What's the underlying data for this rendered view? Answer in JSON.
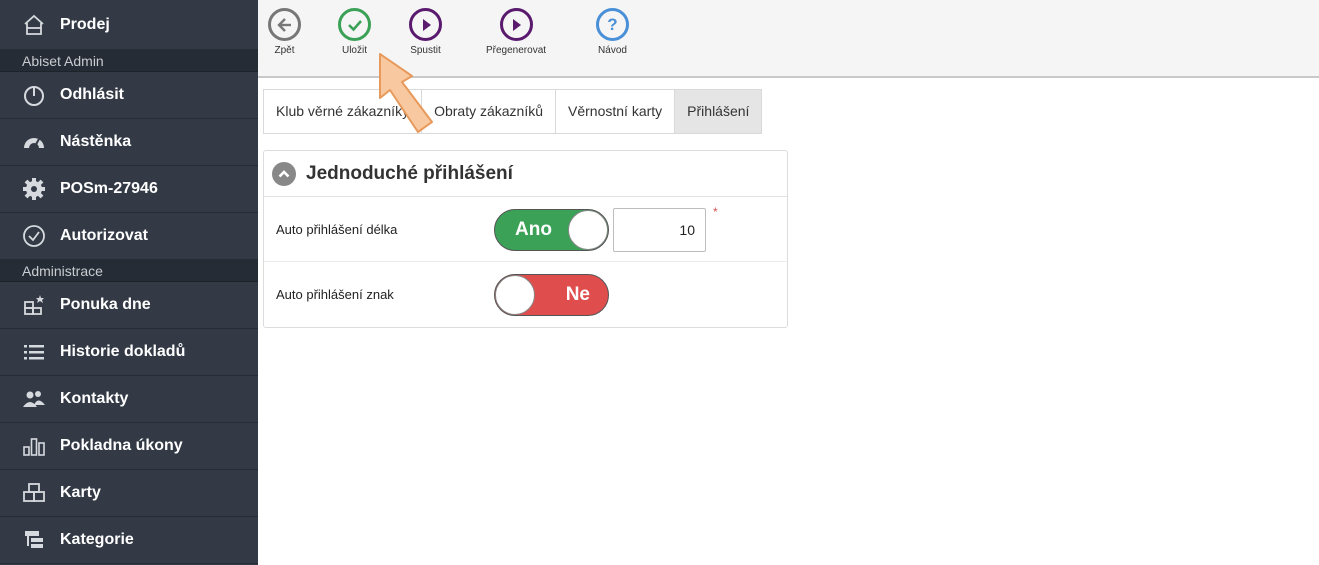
{
  "sidebar": {
    "items": [
      {
        "label": "Prodej",
        "icon": "home-icon"
      },
      {
        "header": "Abiset Admin"
      },
      {
        "label": "Odhlásit",
        "icon": "power-icon"
      },
      {
        "label": "Nástěnka",
        "icon": "dashboard-icon"
      },
      {
        "label": "POSm-27946",
        "icon": "gear-icon"
      },
      {
        "label": "Autorizovat",
        "icon": "check-circle-icon"
      },
      {
        "header": "Administrace"
      },
      {
        "label": "Ponuka dne",
        "icon": "grid-star-icon"
      },
      {
        "label": "Historie dokladů",
        "icon": "list-icon"
      },
      {
        "label": "Kontakty",
        "icon": "users-icon"
      },
      {
        "label": "Pokladna úkony",
        "icon": "bars-icon"
      },
      {
        "label": "Karty",
        "icon": "grid-icon"
      },
      {
        "label": "Kategorie",
        "icon": "category-icon"
      }
    ]
  },
  "toolbar": {
    "buttons": [
      {
        "label": "Zpět",
        "icon": "back-arrow-icon",
        "color": "#777777"
      },
      {
        "label": "Uložit",
        "icon": "check-icon",
        "color": "#3aa157"
      },
      {
        "label": "Spustit",
        "icon": "play-icon",
        "color": "#5a1a6e"
      },
      {
        "label": "Přegenerovat",
        "icon": "play-icon",
        "color": "#5a1a6e"
      },
      {
        "label": "Návod",
        "icon": "question-icon",
        "color": "#4a90d9"
      }
    ]
  },
  "tabs": [
    {
      "label": "Klub věrné zákazníky",
      "active": false
    },
    {
      "label": "Obraty zákazníků",
      "active": false
    },
    {
      "label": "Věrnostní karty",
      "active": false
    },
    {
      "label": "Přihlášení",
      "active": true
    }
  ],
  "panel": {
    "title": "Jednoduché přihlášení",
    "rows": [
      {
        "label": "Auto přihlášení délka",
        "toggle": "Ano",
        "value": "10",
        "required_mark": "*"
      },
      {
        "label": "Auto přihlášení znak",
        "toggle": "Ne"
      }
    ]
  },
  "colors": {
    "sidebar_bg": "#333a45",
    "toggle_on": "#3aa157",
    "toggle_off": "#df4d4d",
    "cursor_arrow": "#f4b27a"
  }
}
